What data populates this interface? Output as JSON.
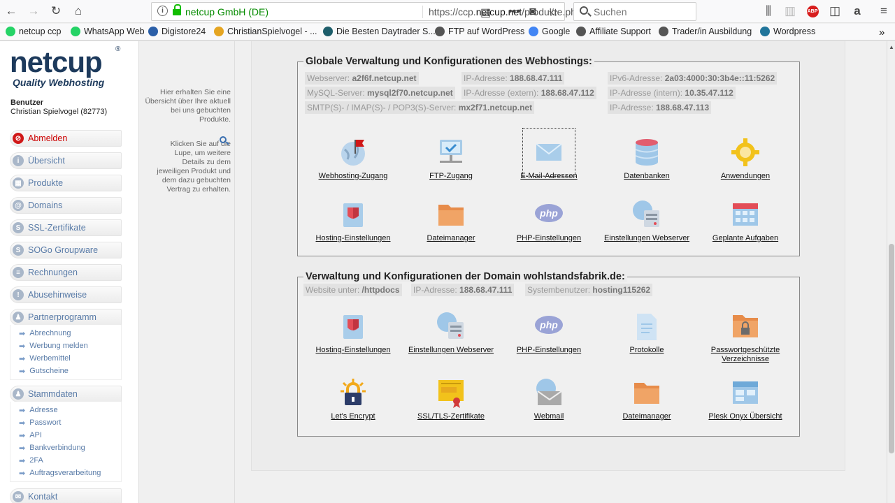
{
  "browser": {
    "site_label": "netcup GmbH (DE)",
    "url_prefix": "https://ccp.",
    "url_domain": "netcup.net",
    "url_rest": "/produkte.php?kate",
    "search_placeholder": "Suchen"
  },
  "bookmarks": [
    {
      "label": "netcup ccp",
      "icon": "whatsapp-icon",
      "color": "#25d366"
    },
    {
      "label": "WhatsApp Web",
      "icon": "whatsapp-icon",
      "color": "#25d366"
    },
    {
      "label": "Digistore24",
      "icon": "digistore-icon",
      "color": "#2b5fa8"
    },
    {
      "label": "ChristianSpielvogel - ...",
      "icon": "pencil-icon",
      "color": "#e5a522"
    },
    {
      "label": "Die Besten Daytrader S...",
      "icon": "chart-icon",
      "color": "#1e5e6b"
    },
    {
      "label": "FTP auf WordPress",
      "icon": "globe-icon",
      "color": "#555555"
    },
    {
      "label": "Google",
      "icon": "google-icon",
      "color": "#4285f4"
    },
    {
      "label": "Affiliate Support",
      "icon": "globe-icon",
      "color": "#555555"
    },
    {
      "label": "Trader/in Ausbildung",
      "icon": "globe-icon",
      "color": "#555555"
    },
    {
      "label": "Wordpress",
      "icon": "wordpress-icon",
      "color": "#21759b"
    }
  ],
  "sidebar": {
    "logo": "netcup",
    "logo_reg": "®",
    "tagline": "Quality Webhosting",
    "user_heading": "Benutzer",
    "user_name": "Christian Spielvogel (82773)",
    "nav": [
      {
        "label": "Abmelden",
        "icon": "logout-icon",
        "glyph": "⊘"
      },
      {
        "label": "Übersicht",
        "icon": "info-icon",
        "glyph": "i"
      },
      {
        "label": "Produkte",
        "icon": "products-icon",
        "glyph": "▦"
      },
      {
        "label": "Domains",
        "icon": "at-icon",
        "glyph": "@"
      },
      {
        "label": "SSL-Zertifikate",
        "icon": "ssl-icon",
        "glyph": "S"
      },
      {
        "label": "SOGo Groupware",
        "icon": "groupware-icon",
        "glyph": "S"
      },
      {
        "label": "Rechnungen",
        "icon": "invoice-icon",
        "glyph": "≡"
      },
      {
        "label": "Abusehinweise",
        "icon": "warning-icon",
        "glyph": "!"
      },
      {
        "label": "Partnerprogramm",
        "icon": "partner-icon",
        "glyph": "♟"
      }
    ],
    "partner_sub": [
      "Abrechnung",
      "Werbung melden",
      "Werbemittel",
      "Gutscheine"
    ],
    "stamm": {
      "label": "Stammdaten",
      "icon": "person-icon",
      "glyph": "♟"
    },
    "stamm_sub": [
      "Adresse",
      "Passwort",
      "API",
      "Bankverbindung",
      "2FA",
      "Auftragsverarbeitung"
    ],
    "kontakt": {
      "label": "Kontakt",
      "icon": "mail-icon",
      "glyph": "✉"
    }
  },
  "info": {
    "p1": "Hier erhalten Sie eine Übersicht über Ihre aktuell bei uns gebuchten Produkte.",
    "p2": "Klicken Sie auf die Lupe, um weitere Details zu dem jeweiligen Produkt und dem dazu gebuchten Vertrag zu erhalten."
  },
  "global": {
    "title": "Globale Verwaltung und Konfigurationen des Webhostings:",
    "pills": [
      {
        "k": "Webserver:",
        "v": "a2f6f.netcup.net"
      },
      {
        "k": "IP-Adresse:",
        "v": "188.68.47.111"
      },
      {
        "k": "IPv6-Adresse:",
        "v": "2a03:4000:30:3b4e::11:5262"
      },
      {
        "k": "MySQL-Server:",
        "v": "mysql2f70.netcup.net"
      },
      {
        "k": "IP-Adresse (extern):",
        "v": "188.68.47.112"
      },
      {
        "k": "IP-Adresse (intern):",
        "v": "10.35.47.112"
      },
      {
        "k": "SMTP(S)- / IMAP(S)- / POP3(S)-Server:",
        "v": "mx2f71.netcup.net"
      },
      {
        "k": "IP-Adresse:",
        "v": "188.68.47.113"
      }
    ],
    "tiles": [
      {
        "label": "Webhosting-Zugang",
        "icon": "webhosting-globe-icon"
      },
      {
        "label": "FTP-Zugang",
        "icon": "ftp-icon"
      },
      {
        "label": "E-Mail-Adressen",
        "icon": "email-envelope-icon"
      },
      {
        "label": "Datenbanken",
        "icon": "database-icon"
      },
      {
        "label": "Anwendungen",
        "icon": "gear-icon"
      },
      {
        "label": "Hosting-Einstellungen",
        "icon": "hosting-settings-icon"
      },
      {
        "label": "Dateimanager",
        "icon": "folder-icon"
      },
      {
        "label": "PHP-Einstellungen",
        "icon": "php-icon"
      },
      {
        "label": "Einstellungen Webserver",
        "icon": "webserver-icon"
      },
      {
        "label": "Geplante Aufgaben",
        "icon": "calendar-icon"
      }
    ]
  },
  "domain": {
    "title": "Verwaltung und Konfigurationen der Domain wohlstandsfabrik.de:",
    "pills": [
      {
        "k": "Website unter:",
        "v": "/httpdocs"
      },
      {
        "k": "IP-Adresse:",
        "v": "188.68.47.111"
      },
      {
        "k": "Systembenutzer:",
        "v": "hosting115262"
      }
    ],
    "tiles": [
      {
        "label": "Hosting-Einstellungen",
        "icon": "hosting-settings-icon"
      },
      {
        "label": "Einstellungen Webserver",
        "icon": "webserver-icon"
      },
      {
        "label": "PHP-Einstellungen",
        "icon": "php-icon"
      },
      {
        "label": "Protokolle",
        "icon": "log-file-icon"
      },
      {
        "label": "Passwortgeschützte Verzeichnisse",
        "icon": "locked-folder-icon"
      },
      {
        "label": "Let's Encrypt",
        "icon": "letsencrypt-lock-icon"
      },
      {
        "label": "SSL/TLS-Zertifikate",
        "icon": "certificate-icon"
      },
      {
        "label": "Webmail",
        "icon": "webmail-icon"
      },
      {
        "label": "Dateimanager",
        "icon": "folder-icon"
      },
      {
        "label": "Plesk Onyx Übersicht",
        "icon": "dashboard-icon"
      }
    ]
  }
}
